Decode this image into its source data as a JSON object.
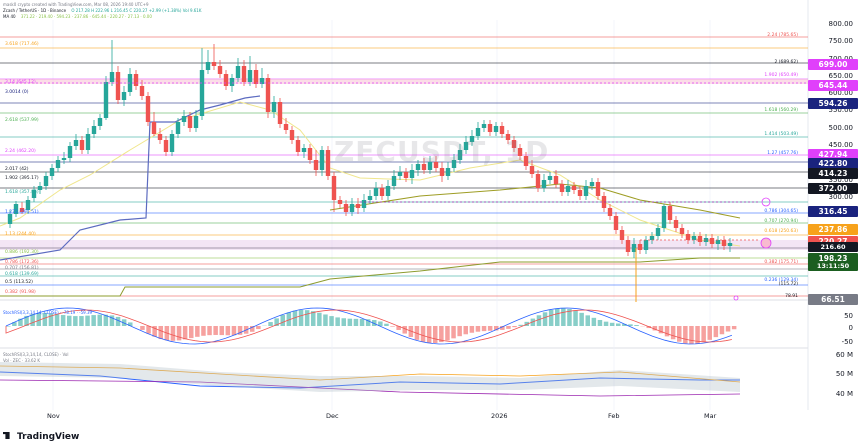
{
  "header": {
    "credit": "mask0 crypto created with TradingView.com, Mar 08, 2026 19:40 UTC+9",
    "symbol": "Zcash / TetherUS · 1D · Binance",
    "ohlc": "O 217.28 H 222.96 L 216.45 C 220.27 +2.99 (+1.38%) Vol 9.61K",
    "ma_label": "MA 40",
    "ma_values": "371.22 · 219.40 · 594.23 · 237.86 · 645.44 · 220.27 · 27.13 · 0.00"
  },
  "watermark": "ZECUSDT, 1D",
  "indicators": {
    "stoch": "StochRSI(3,3,14,14, CLOSE)  ·  -78.19  ·  -59.39",
    "stoch2": "StochRSI(3,3,14,14, CLOSE) · Vol",
    "vol": "Vol · ZEC · 33.62 K"
  },
  "price_axis": [
    "800.00",
    "750.00",
    "700.00",
    "650.00",
    "600.00",
    "550.00",
    "500.00",
    "450.00",
    "400.00",
    "350.00",
    "300.00",
    "250.00",
    "200.00",
    "150.00",
    "100.00"
  ],
  "price_tags": [
    {
      "label": "699.00",
      "color": "#e040fb"
    },
    {
      "label": "645.44",
      "color": "#e040fb"
    },
    {
      "label": "594.26",
      "color": "#1a237e"
    },
    {
      "label": "427.94",
      "color": "#e040fb"
    },
    {
      "label": "422.80",
      "color": "#1a237e"
    },
    {
      "label": "414.23",
      "color": "#131722"
    },
    {
      "label": "372.00",
      "color": "#131722"
    },
    {
      "label": "316.45",
      "color": "#1a237e"
    },
    {
      "label": "237.86",
      "color": "#f7a21b"
    },
    {
      "label": "220.27",
      "color": "#ef5350"
    },
    {
      "label": "216.60",
      "color": "#131722"
    },
    {
      "label": "198.23",
      "color": "#1b5e20"
    },
    {
      "label": "13:11:50",
      "color": "#1b5e20"
    },
    {
      "label": "66.51",
      "color": "#787b86"
    }
  ],
  "fib_left": [
    {
      "text": "3.618 (717.46)",
      "color": "#f7a21b"
    },
    {
      "text": "3.14 (645.12)",
      "color": "#e040fb"
    },
    {
      "text": "3.0014 (0)",
      "color": "#1a237e"
    },
    {
      "text": "2.618 (537.99)",
      "color": "#4caf50"
    },
    {
      "text": "2.24 (462.20)",
      "color": "#e040fb"
    },
    {
      "text": "2.017 (42)",
      "color": "#131722"
    },
    {
      "text": "1.902 (395.17)",
      "color": "#131722"
    },
    {
      "text": "1.618 (357.85)",
      "color": "#26a69a"
    },
    {
      "text": "1.272 (291.51)",
      "color": "#2962ff"
    },
    {
      "text": "1.13 (244.40)",
      "color": "#f7a21b"
    },
    {
      "text": "0.886 (192.30)",
      "color": "#8bc34a"
    },
    {
      "text": "0.786 (172.36)",
      "color": "#ef5350"
    },
    {
      "text": "0.707 (156.81)",
      "color": "#787b86"
    },
    {
      "text": "0.618 (139.69)",
      "color": "#26a69a"
    },
    {
      "text": "0.5 (113.52)",
      "color": "#131722"
    },
    {
      "text": "0.382 (91.98)",
      "color": "#ef5350"
    }
  ],
  "fib_right": [
    {
      "text": "2.24 (785.65)",
      "color": "#ef5350"
    },
    {
      "text": "2 (689.62)",
      "color": "#131722"
    },
    {
      "text": "1.902 (650.49)",
      "color": "#e040fb"
    },
    {
      "text": "1.618 (560.29)",
      "color": "#4caf50"
    },
    {
      "text": "1.414 (503.49)",
      "color": "#26a69a"
    },
    {
      "text": "1.27 (457.76)",
      "color": "#2962ff"
    },
    {
      "text": "0.786 (304.65)",
      "color": "#2962ff"
    },
    {
      "text": "0.707 (270.94)",
      "color": "#4caf50"
    },
    {
      "text": "0.618 (250.63)",
      "color": "#f7a21b"
    },
    {
      "text": "0.382 (175.71)",
      "color": "#ef5350"
    },
    {
      "text": "0.236 (129.34)",
      "color": "#2962ff"
    },
    {
      "text": "(115.72)",
      "color": "#131722"
    },
    {
      "text": "78.91",
      "color": "#131722"
    }
  ],
  "lower_axis": [
    {
      "label": "50",
      "pane": "stoch"
    },
    {
      "label": "0",
      "pane": "stoch"
    },
    {
      "label": "-50",
      "pane": "stoch"
    },
    {
      "label": "60 M",
      "pane": "vol"
    },
    {
      "label": "50 M",
      "pane": "vol"
    },
    {
      "label": "40 M",
      "pane": "vol"
    }
  ],
  "time_axis": [
    "Nov",
    "Dec",
    "2026",
    "Feb",
    "Mar"
  ],
  "logo": "TradingView"
}
